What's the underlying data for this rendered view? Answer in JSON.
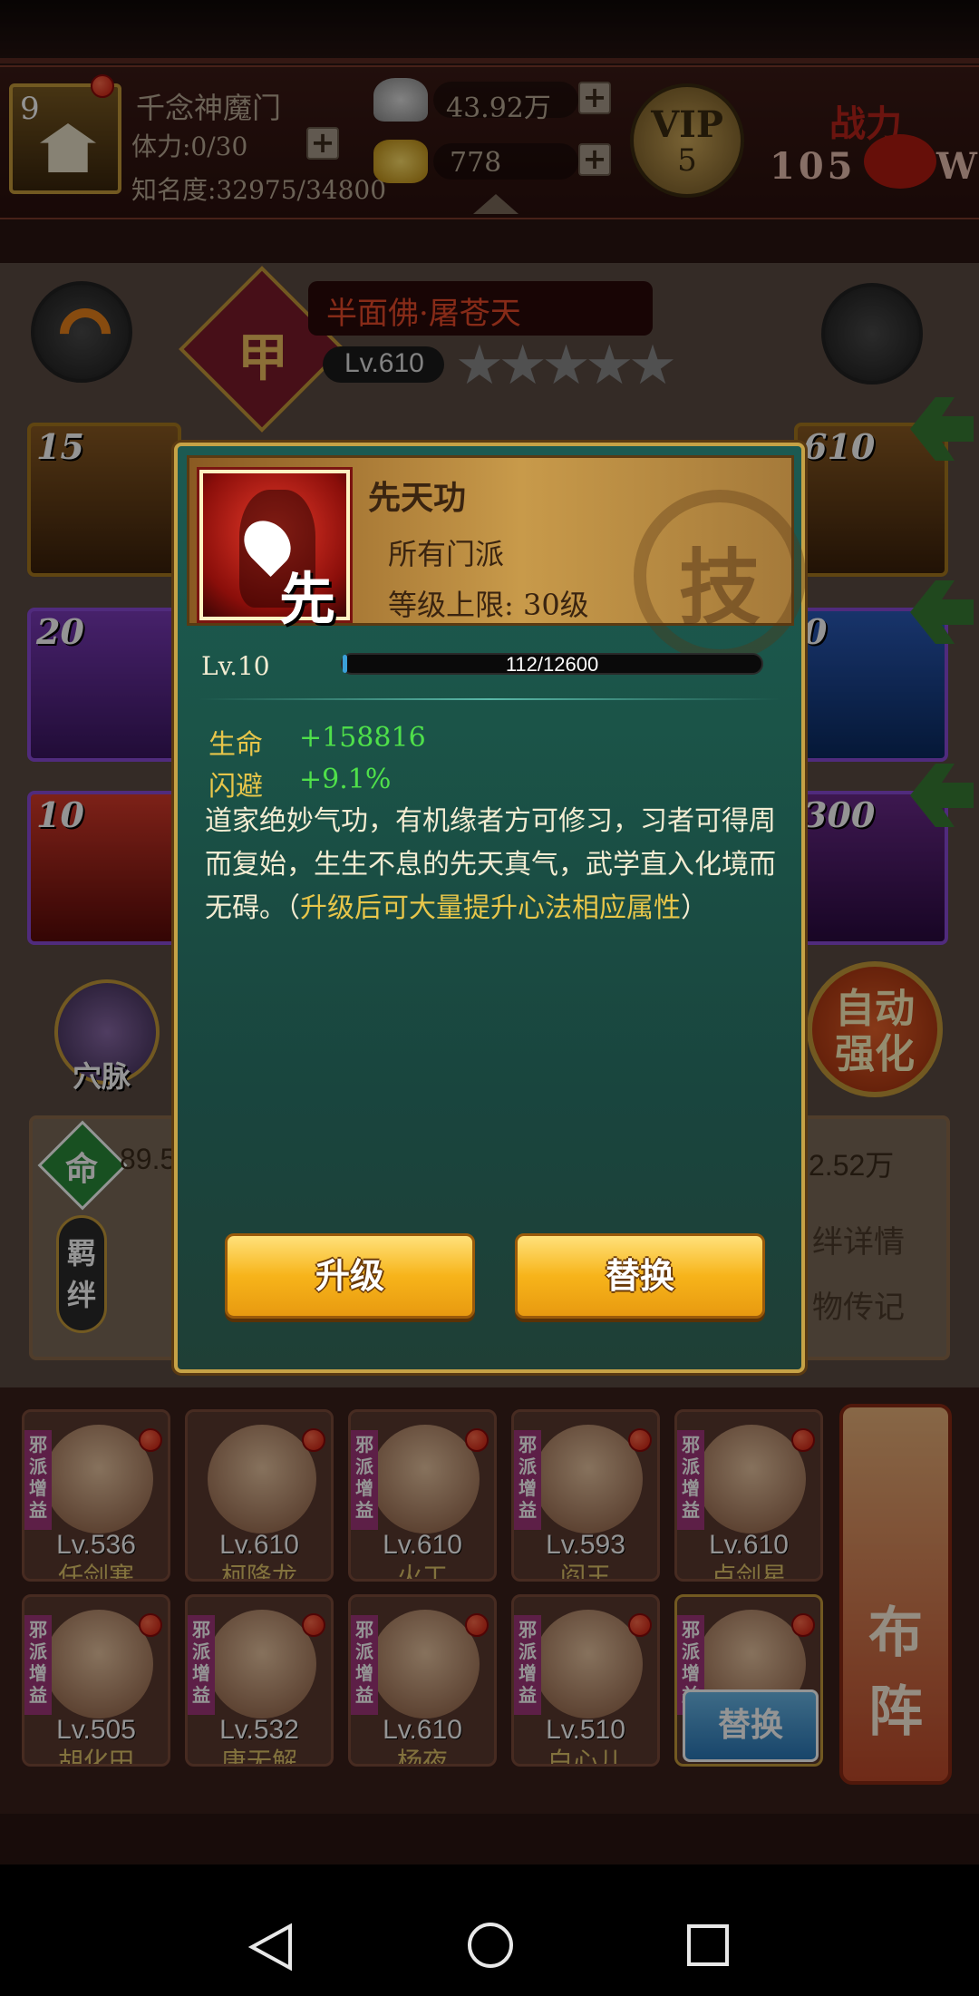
{
  "header": {
    "sect_level": "9",
    "sect_name": "千念神魔门",
    "stamina": "体力:0/30",
    "fame": "知名度:32975/34800",
    "silver": "43.92万",
    "gold": "778",
    "vip_label": "VIP",
    "vip_level": "5",
    "power_label": "战力",
    "power_value": "105",
    "power_suffix": "W"
  },
  "hero": {
    "name": "半面佛·屠苍天",
    "rank_badge": "甲",
    "level": "Lv.610",
    "stars": 5
  },
  "slots": {
    "left": [
      {
        "num": "15"
      },
      {
        "num": "20"
      },
      {
        "num": "10"
      }
    ],
    "right": [
      {
        "num": "610"
      },
      {
        "num": "0"
      },
      {
        "num": "300"
      }
    ]
  },
  "side": {
    "acupoint": "穴脉",
    "auto_line1": "自动",
    "auto_line2": "强化"
  },
  "stats_panel": {
    "life_badge": "命",
    "life_value": "89.5",
    "right_value": "2.52万",
    "bond_badge": "羁绊",
    "bond_detail": "绊详情",
    "biography": "物传记"
  },
  "dialog": {
    "skill_title": "先天功",
    "icon_char": "先",
    "school": "所有门派",
    "level_cap": "等级上限: 30级",
    "seal_char": "技",
    "level": "Lv.10",
    "exp_text": "112/12600",
    "exp_ratio": 0.0089,
    "stats": [
      {
        "name": "生命",
        "value": "+158816"
      },
      {
        "name": "闪避",
        "value": "+9.1%"
      }
    ],
    "desc_white": "道家绝妙气功，有机缘者方可修习，习者可得周而复始，生生不息的先天真气，武学直入化境而无碍。（",
    "desc_yellow": "升级后可大量提升心法相应属性",
    "desc_close": "）",
    "upgrade_button": "升级",
    "replace_button": "替换"
  },
  "roster": [
    {
      "tag": "邪派增益",
      "level": "Lv.536",
      "name": "任剑寒"
    },
    {
      "tag": "邪派增益",
      "level": "Lv.610",
      "name": "柯降龙"
    },
    {
      "tag": "邪派增益",
      "level": "Lv.610",
      "name": "火工"
    },
    {
      "tag": "邪派增益",
      "level": "Lv.593",
      "name": "阎王"
    },
    {
      "tag": "邪派增益",
      "level": "Lv.610",
      "name": "卢剑星"
    },
    {
      "tag": "邪派增益",
      "level": "Lv.505",
      "name": "胡化田"
    },
    {
      "tag": "邪派增益",
      "level": "Lv.532",
      "name": "唐无解"
    },
    {
      "tag": "邪派增益",
      "level": "Lv.610",
      "name": "杨夜"
    },
    {
      "tag": "邪派增益",
      "level": "Lv.510",
      "name": "白心儿"
    },
    {
      "tag": "邪派增益",
      "level": "",
      "name": "",
      "button": "替换"
    }
  ],
  "formation_button": {
    "line1": "布",
    "line2": "阵"
  },
  "colors": {
    "dialog_bg": "#1b5448",
    "gold_button": "#f7b41a",
    "stat_green": "#4fe04a",
    "highlight_yellow": "#e8c64a"
  }
}
